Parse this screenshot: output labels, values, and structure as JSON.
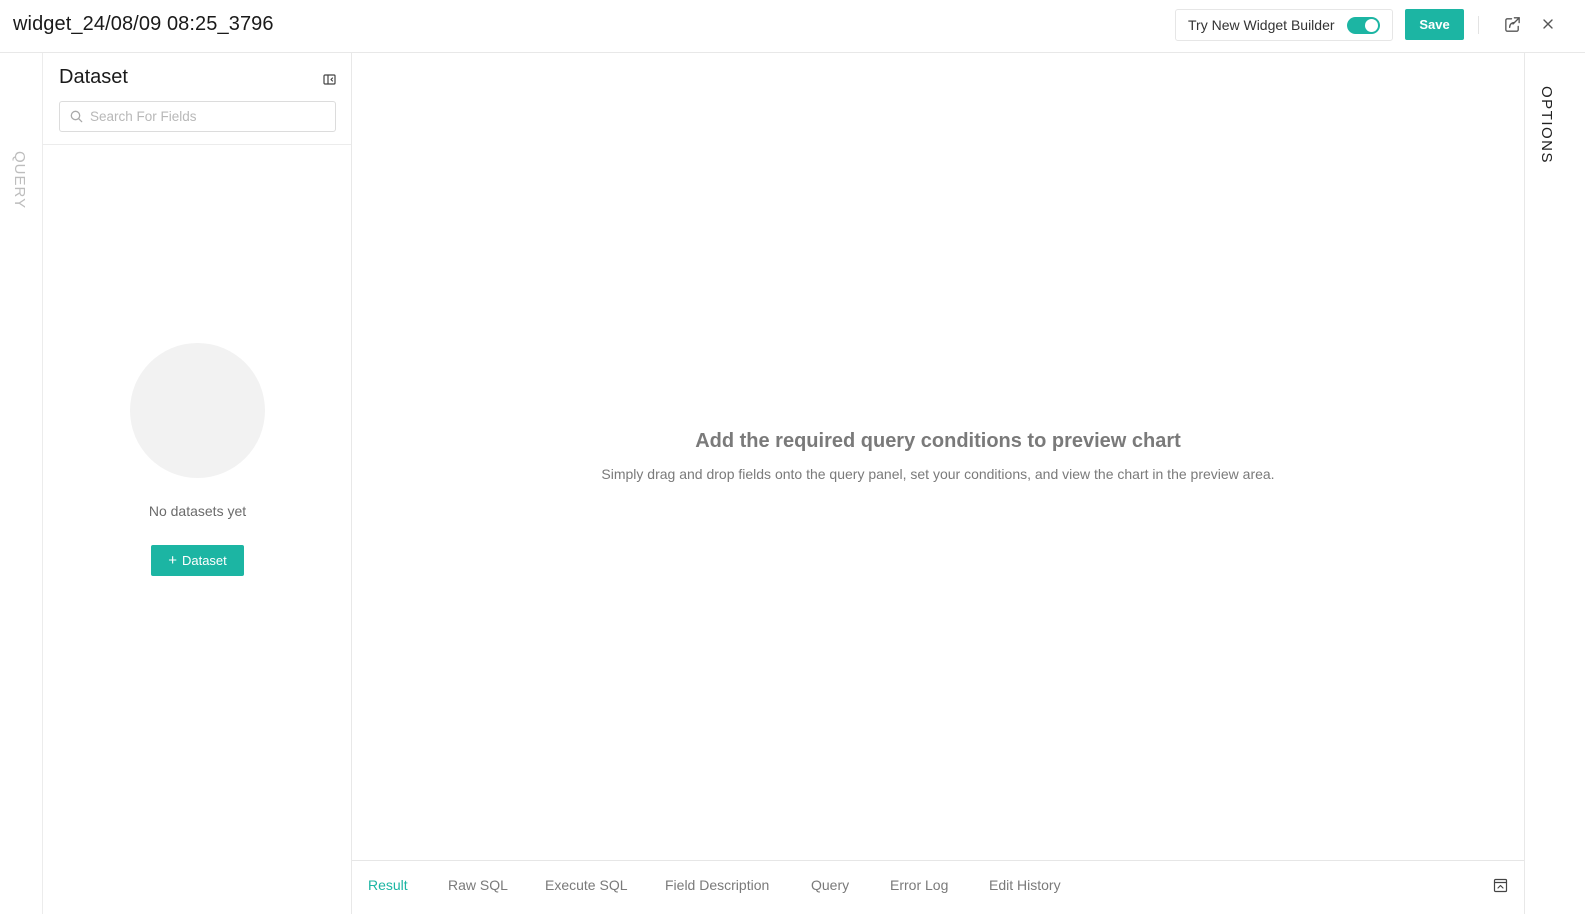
{
  "header": {
    "title": "widget_24/08/09 08:25_3796",
    "builder_label": "Try New Widget Builder",
    "builder_enabled": true,
    "save_label": "Save"
  },
  "query_tab": {
    "label": "QUERY"
  },
  "dataset_panel": {
    "title": "Dataset",
    "search": {
      "placeholder": "Search For Fields",
      "value": ""
    },
    "empty_text": "No datasets yet",
    "add_button_label": "Dataset"
  },
  "preview": {
    "heading": "Add the required query conditions to preview chart",
    "subtext": "Simply drag and drop fields onto the query panel, set your conditions, and view the chart in the preview area."
  },
  "bottom_tabs": {
    "active": "Result",
    "items": [
      {
        "label": "Result"
      },
      {
        "label": "Raw SQL"
      },
      {
        "label": "Execute SQL"
      },
      {
        "label": "Field Description"
      },
      {
        "label": "Query"
      },
      {
        "label": "Error Log"
      },
      {
        "label": "Edit History"
      }
    ]
  },
  "options_tab": {
    "label": "OPTIONS"
  },
  "colors": {
    "accent": "#1cb5a3",
    "muted_text": "#7a7a7a",
    "border": "#e8e8e8"
  },
  "icons": {
    "share": "share-icon",
    "close": "close-icon",
    "collapse": "collapse-panel-icon",
    "search": "search-icon",
    "plus": "plus-icon",
    "expand": "expand-panel-icon"
  }
}
